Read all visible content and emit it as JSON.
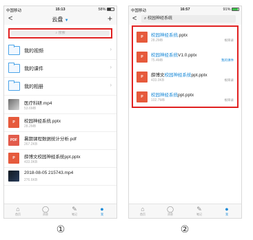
{
  "screen1": {
    "status": {
      "carrier": "中国移动",
      "time": "15:13",
      "battery": "58%"
    },
    "nav": {
      "back": "<",
      "title": "云盘",
      "add": "+"
    },
    "search_placeholder": "搜索",
    "folders": [
      {
        "label": "我的视频"
      },
      {
        "label": "我的课件"
      },
      {
        "label": "我的相册"
      }
    ],
    "files": [
      {
        "icon": "image-thumb-icon",
        "name": "医疗科研.mp4",
        "size": "53.6MB"
      },
      {
        "icon": "ppt-file-icon",
        "thumb_label": "P",
        "name": "校园神经系统.pptx",
        "size": "28.2MB"
      },
      {
        "icon": "pdf-file-icon",
        "thumb_label": "PDF",
        "name": "暑期课程数据统计分析.pdf",
        "size": "267.2KB"
      },
      {
        "icon": "ppt-file-icon",
        "thumb_label": "P",
        "name": "薛博文校园神经系统ppt.pptx",
        "size": "433.0KB"
      },
      {
        "icon": "video-thumb-icon",
        "name": "2018-08-05 215743.mp4",
        "size": "276.6KB"
      }
    ],
    "tabs": [
      {
        "label": "首页"
      },
      {
        "label": "消息"
      },
      {
        "label": "笔记"
      },
      {
        "label": "我",
        "active": true
      }
    ],
    "caption": "①"
  },
  "screen2": {
    "status": {
      "carrier": "中国移动",
      "time": "16:57",
      "battery": "91%"
    },
    "query": "校园神经系统",
    "results": [
      {
        "pre": "",
        "hl": "校园神经系统",
        "post": ".pptx",
        "size": "28.2MB",
        "tag": "根目录",
        "tag_blue": false
      },
      {
        "pre": "",
        "hl": "校园神经系统",
        "post": "V1.0.pptx",
        "size": "75.4MB",
        "tag": "我的课件",
        "tag_blue": true
      },
      {
        "pre": "薛博文",
        "hl": "校园神经系统",
        "post": "ppt.pptx",
        "size": "433.0KB",
        "tag": "根目录",
        "tag_blue": false
      },
      {
        "pre": "",
        "hl": "校园神经系统",
        "post": "ppt.pptx",
        "size": "102.7MB",
        "tag": "根目录",
        "tag_blue": false
      }
    ],
    "tabs": [
      {
        "label": "首页"
      },
      {
        "label": "消息"
      },
      {
        "label": "笔记"
      },
      {
        "label": "我",
        "active": true
      }
    ],
    "caption": "②"
  },
  "colors": {
    "accent": "#1a8ad8",
    "highlight_box": "#e02020",
    "ppt": "#e65a3c"
  }
}
